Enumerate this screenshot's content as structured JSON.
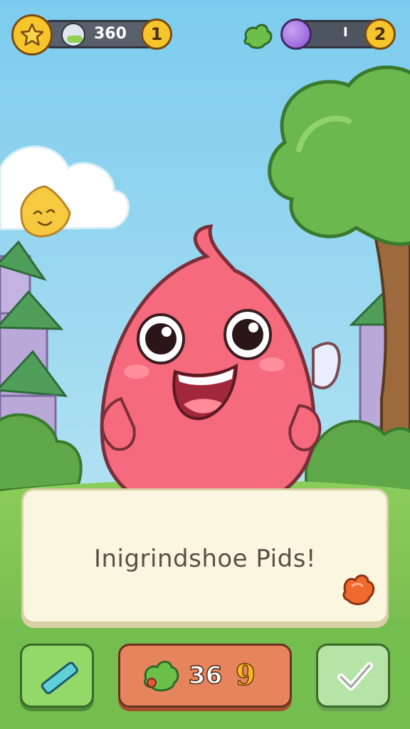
{
  "hud": {
    "left": {
      "star_icon": "star-icon",
      "avatar_icon": "creature-avatar-icon",
      "currency_value": "360",
      "coin_value": "1"
    },
    "right": {
      "leaf_icon": "green-leaf-icon",
      "orb_icon": "purple-orb-icon",
      "orb_value": "I",
      "coin_value": "2"
    }
  },
  "pet_panel": {
    "title": "Inigrindshoe Pids!",
    "reward_icon": "orange-leaf-icon"
  },
  "bottom_bar": {
    "left_button_icon": "pencil-icon",
    "center_button": {
      "icon": "green-food-icon",
      "count": "36",
      "badge": "9"
    },
    "right_button_icon": "checkmark-icon"
  },
  "colors": {
    "sky": "#8fd3ee",
    "pet_body": "#f56a7c",
    "grass": "#7cc354",
    "panel": "#fbf6df",
    "button_green": "#8fd66a",
    "button_orange": "#e6845e",
    "coin": "#f6c52b"
  }
}
